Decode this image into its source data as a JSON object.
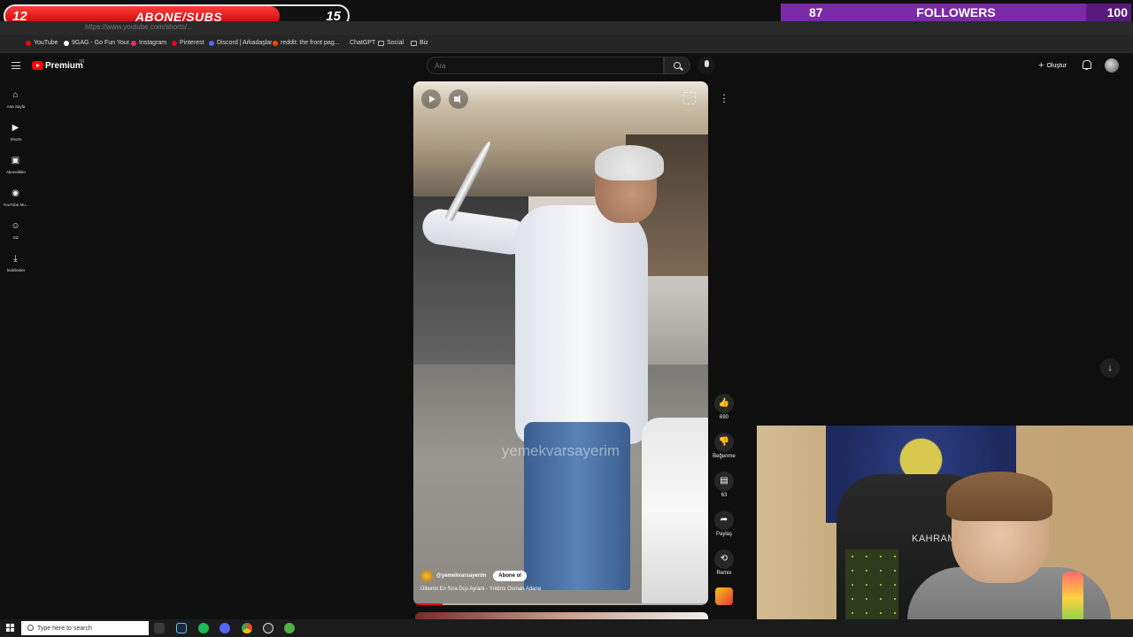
{
  "overlay": {
    "subs_goal": {
      "current": "12",
      "label": "ABONE/SUBS",
      "target": "15",
      "progress": 0.8
    },
    "followers_goal": {
      "current": "87",
      "label": "FOLLOWERS",
      "target": "100",
      "progress": 0.87
    }
  },
  "browser": {
    "url": "https://www.youtube.com/shorts/...",
    "bookmarks": [
      {
        "label": "YouTube",
        "color": "#ff0000"
      },
      {
        "label": "9GAG - Go Fun Your...",
        "color": "#ffffff"
      },
      {
        "label": "Instagram",
        "color": "#e1306c"
      },
      {
        "label": "Pinterest",
        "color": "#e60023"
      },
      {
        "label": "Discord | Arkadaşlar",
        "color": "#5865f2"
      },
      {
        "label": "reddit: the front pag...",
        "color": "#ff4500"
      },
      {
        "label": "ChatGPT",
        "color": "#222222"
      },
      {
        "label": "Social",
        "color": "folder"
      },
      {
        "label": "Biz",
        "color": "folder"
      }
    ]
  },
  "youtube": {
    "logo_text": "Premium",
    "logo_region": "TR",
    "search_placeholder": "Ara",
    "create_label": "Oluştur",
    "sidebar": [
      {
        "label": "Ana Sayfa",
        "icon": "home-icon"
      },
      {
        "label": "Shorts",
        "icon": "shorts-icon"
      },
      {
        "label": "Abonelikler",
        "icon": "subscriptions-icon"
      },
      {
        "label": "YouTube Mu...",
        "icon": "youtube-music-icon"
      },
      {
        "label": "Siz",
        "icon": "you-icon"
      },
      {
        "label": "İndirilenler",
        "icon": "download-icon"
      }
    ],
    "short": {
      "watermark": "yemekvarsayerim",
      "channel": "@yemekvarsayerim",
      "subscribe_label": "Abone ol",
      "title": "Ülkenin En Sıra Dışı Ayranı - Yıldırcı Osman Adana",
      "progress": 0.1
    },
    "actions": {
      "like_count": "690",
      "dislike_label": "Beğenme",
      "comment_count": "63",
      "share_label": "Paylaş",
      "remix_label": "Remix"
    }
  },
  "webcam": {
    "chair_text": "KAHRAM"
  },
  "taskbar": {
    "search_placeholder": "Type here to search",
    "apps": [
      "task-view",
      "steam",
      "spotify",
      "discord",
      "chrome",
      "obs",
      "xbox"
    ]
  }
}
